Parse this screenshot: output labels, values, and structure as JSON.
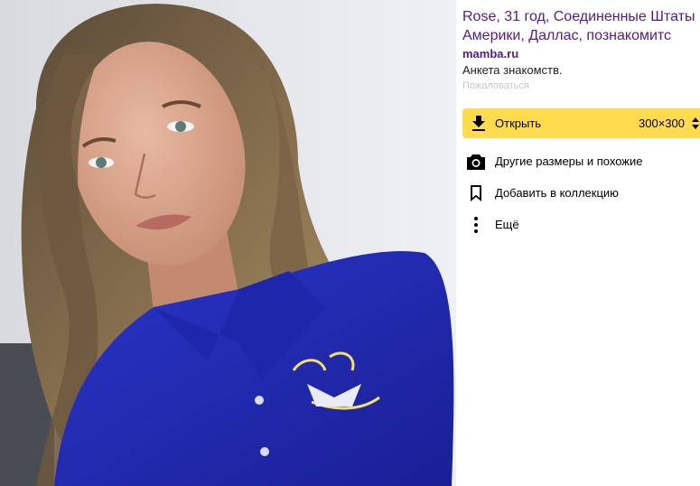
{
  "photo": {
    "alt": "selfie photo",
    "shirt_color": "#1f2bb8",
    "background_color": "#e6e7ea"
  },
  "info": {
    "title_line1": "Rose, 31 год, Соединенные Штаты",
    "title_line2": "Америки, Даллас, познакомитс",
    "domain": "mamba.ru",
    "description": "Анкета знакомств.",
    "complain": "Пожаловаться"
  },
  "actions": {
    "open_label": "Открыть",
    "size_selected": "300×300",
    "accent_color": "#ffdb4d"
  },
  "menu": [
    {
      "icon": "camera-icon",
      "label": "Другие размеры и похожие"
    },
    {
      "icon": "bookmark-icon",
      "label": "Добавить в коллекцию"
    },
    {
      "icon": "more-vertical-icon",
      "label": "Ещё"
    }
  ]
}
